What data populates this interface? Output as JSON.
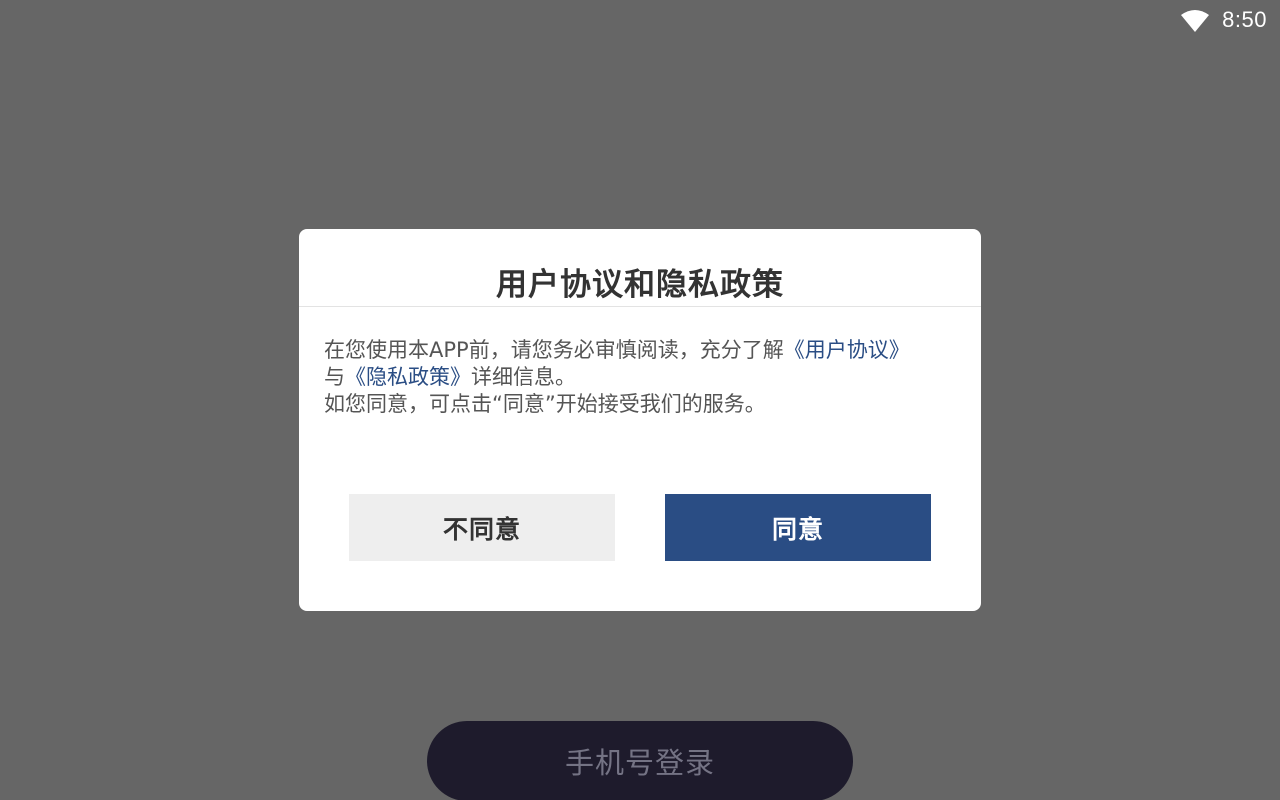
{
  "status_bar": {
    "wifi_icon": "wifi-icon",
    "time": "8:50"
  },
  "login": {
    "button_label": "手机号登录"
  },
  "dialog": {
    "title": "用户协议和隐私政策",
    "body": {
      "text_1": "在您使用本APP前，请您务必审慎阅读，充分了解",
      "user_agreement_link": "《用户协议》",
      "text_2": "与",
      "privacy_policy_link": "《隐私政策》",
      "text_3": "详细信息。",
      "line_2": "如您同意，可点击“同意”开始接受我们的服务。"
    },
    "disagree_label": "不同意",
    "agree_label": "同意"
  },
  "colors": {
    "overlay_background": "#666666",
    "accent": "#2a4d84",
    "disagree_button": "#eeeeee",
    "login_button": "#1e1b2c"
  }
}
